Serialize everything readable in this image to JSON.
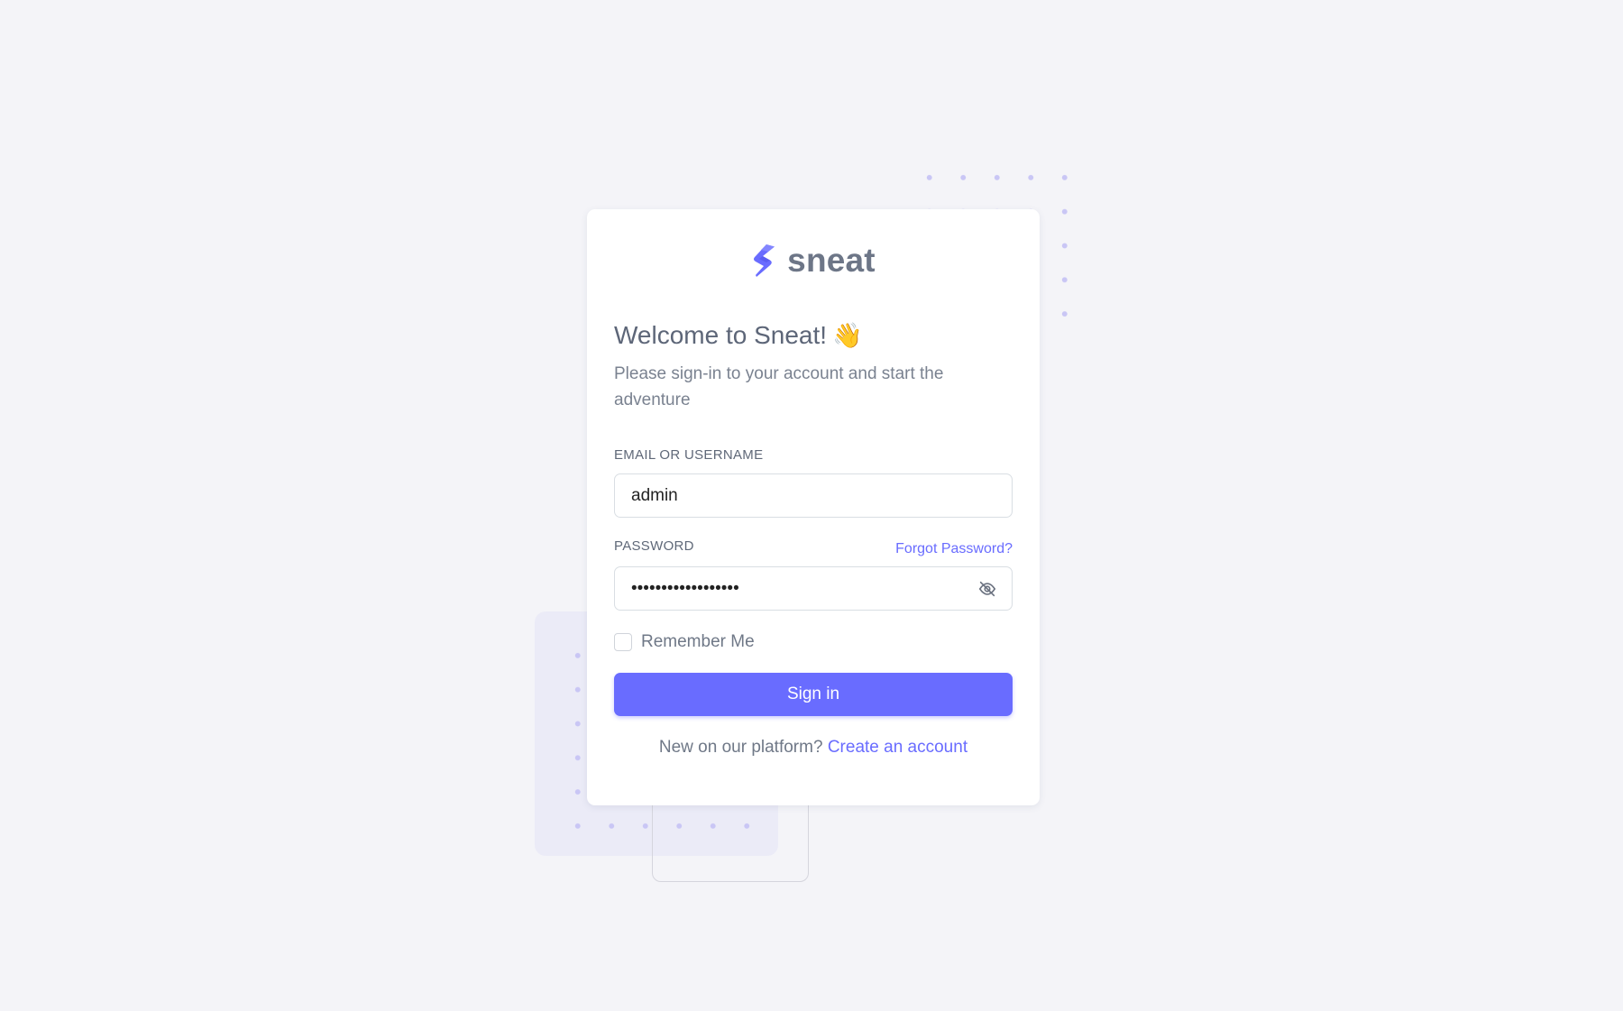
{
  "brand": {
    "name": "sneat",
    "logo_color": "#696cff"
  },
  "welcome": {
    "title": "Welcome to Sneat!",
    "emoji": "👋",
    "subtitle": "Please sign-in to your account and start the adventure"
  },
  "form": {
    "email_label": "EMAIL OR USERNAME",
    "email_value": "admin",
    "password_label": "PASSWORD",
    "password_value": "••••••••••••••••••",
    "forgot_label": "Forgot Password?",
    "password_toggle_icon": "eye-off-icon",
    "remember_label": "Remember Me",
    "remember_checked": false,
    "signin_label": "Sign in"
  },
  "footer": {
    "prompt": "New on our platform?",
    "link_label": "Create an account"
  },
  "colors": {
    "primary": "#696cff",
    "background": "#f4f4f8",
    "heading": "#5d6678",
    "text": "#7a8290"
  }
}
